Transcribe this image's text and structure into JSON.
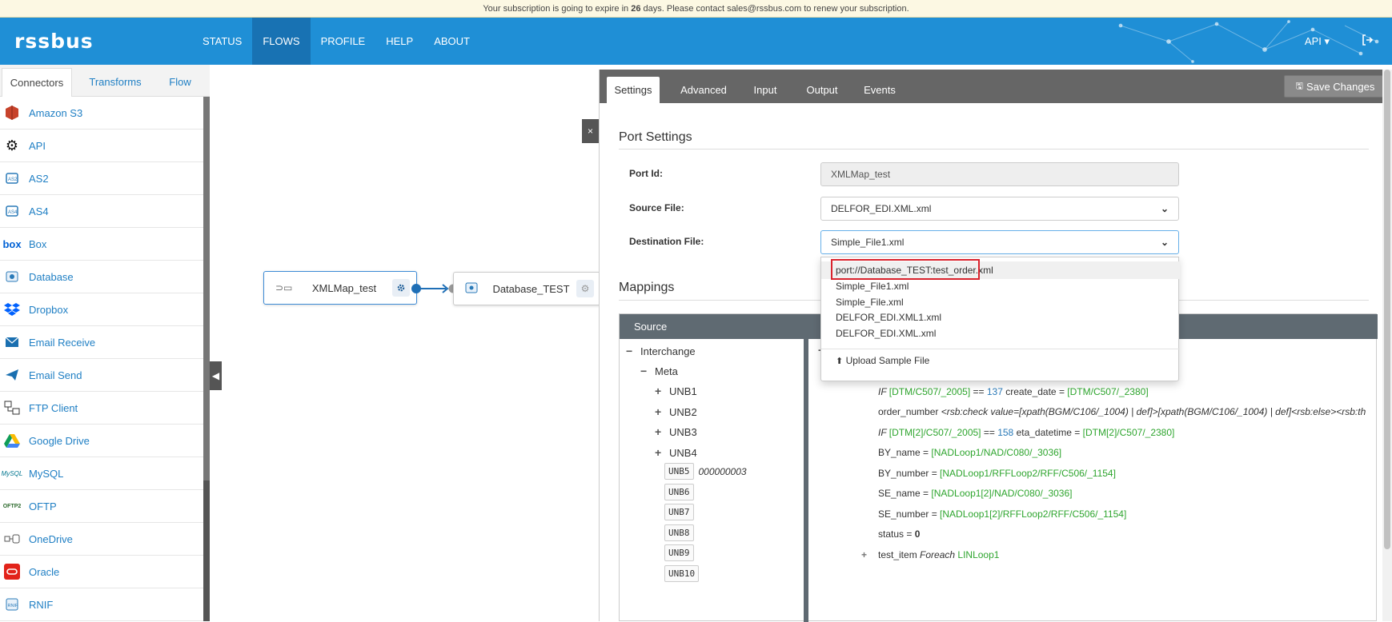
{
  "banner": {
    "prefix": "Your subscription is going to expire in ",
    "days": "26",
    "suffix": " days. Please contact sales@rssbus.com to renew your subscription."
  },
  "header": {
    "logo": "rssbus",
    "nav": [
      "STATUS",
      "FLOWS",
      "PROFILE",
      "HELP",
      "ABOUT"
    ],
    "active_nav": "FLOWS",
    "api_label": "API ▾"
  },
  "left_tabs": [
    "Connectors",
    "Transforms",
    "Flow"
  ],
  "connectors": [
    {
      "label": "Amazon S3",
      "icon": "amazon-s3-icon"
    },
    {
      "label": "API",
      "icon": "gears-icon"
    },
    {
      "label": "AS2",
      "icon": "as2-icon"
    },
    {
      "label": "AS4",
      "icon": "as4-icon"
    },
    {
      "label": "Box",
      "icon": "box-icon"
    },
    {
      "label": "Database",
      "icon": "database-icon"
    },
    {
      "label": "Dropbox",
      "icon": "dropbox-icon"
    },
    {
      "label": "Email Receive",
      "icon": "envelope-icon"
    },
    {
      "label": "Email Send",
      "icon": "paper-plane-icon"
    },
    {
      "label": "FTP Client",
      "icon": "ftp-icon"
    },
    {
      "label": "Google Drive",
      "icon": "google-drive-icon"
    },
    {
      "label": "MySQL",
      "icon": "mysql-icon"
    },
    {
      "label": "OFTP",
      "icon": "oftp-icon"
    },
    {
      "label": "OneDrive",
      "icon": "onedrive-icon"
    },
    {
      "label": "Oracle",
      "icon": "oracle-icon"
    },
    {
      "label": "RNIF",
      "icon": "rnif-icon"
    }
  ],
  "canvas": {
    "node1": "XMLMap_test",
    "node2": "Database_TEST",
    "close": "×"
  },
  "right_tabs": [
    "Settings",
    "Advanced",
    "Input",
    "Output",
    "Events"
  ],
  "save_button": "Save Changes",
  "port_settings": {
    "title": "Port Settings",
    "port_id_label": "Port Id:",
    "port_id_value": "XMLMap_test",
    "source_label": "Source File:",
    "source_value": "DELFOR_EDI.XML.xml",
    "dest_label": "Destination File:",
    "dest_value": "Simple_File1.xml"
  },
  "dropdown_options": [
    "port://Database_TEST:test_order.xml",
    "Simple_File1.xml",
    "Simple_File.xml",
    "DELFOR_EDI.XML1.xml",
    "DELFOR_EDI.XML.xml"
  ],
  "upload_label": "Upload Sample File",
  "mappings": {
    "title": "Mappings",
    "source_header": "Source",
    "tree": {
      "root": "Interchange",
      "meta": "Meta",
      "unb_expandable": [
        "UNB1",
        "UNB2",
        "UNB3",
        "UNB4"
      ],
      "unb_leaf": [
        "UNB5",
        "UNB6",
        "UNB7",
        "UNB8",
        "UNB9",
        "UNB10"
      ],
      "unb5_value": "000000003"
    },
    "lines": {
      "l1_if": "IF ",
      "l1_path": "[DTM/C507/_2005]",
      "l1_op": " == ",
      "l1_num": "137",
      "l1_field": " create_date = ",
      "l1_value": "[DTM/C507/_2380]",
      "l2_field": "order_number ",
      "l2_expr": "<rsb:check value=[xpath(BGM/C106/_1004) | def]>[xpath(BGM/C106/_1004) | def]<rsb:else><rsb:th",
      "l3_if": "IF ",
      "l3_path": "[DTM[2]/C507/_2005]",
      "l3_op": " == ",
      "l3_num": "158",
      "l3_field": " eta_datetime = ",
      "l3_value": "[DTM[2]/C507/_2380]",
      "l4_field": "BY_name = ",
      "l4_value": "[NADLoop1/NAD/C080/_3036]",
      "l5_field": "BY_number = ",
      "l5_value": "[NADLoop1/RFFLoop2/RFF/C506/_1154]",
      "l6_field": "SE_name = ",
      "l6_value": "[NADLoop1[2]/NAD/C080/_3036]",
      "l7_field": "SE_number = ",
      "l7_value": "[NADLoop1[2]/RFFLoop2/RFF/C506/_1154]",
      "l8_field": "status = ",
      "l8_value": "0",
      "l9_field": "test_item ",
      "l9_foreach": "Foreach ",
      "l9_value": "LINLoop1"
    }
  }
}
